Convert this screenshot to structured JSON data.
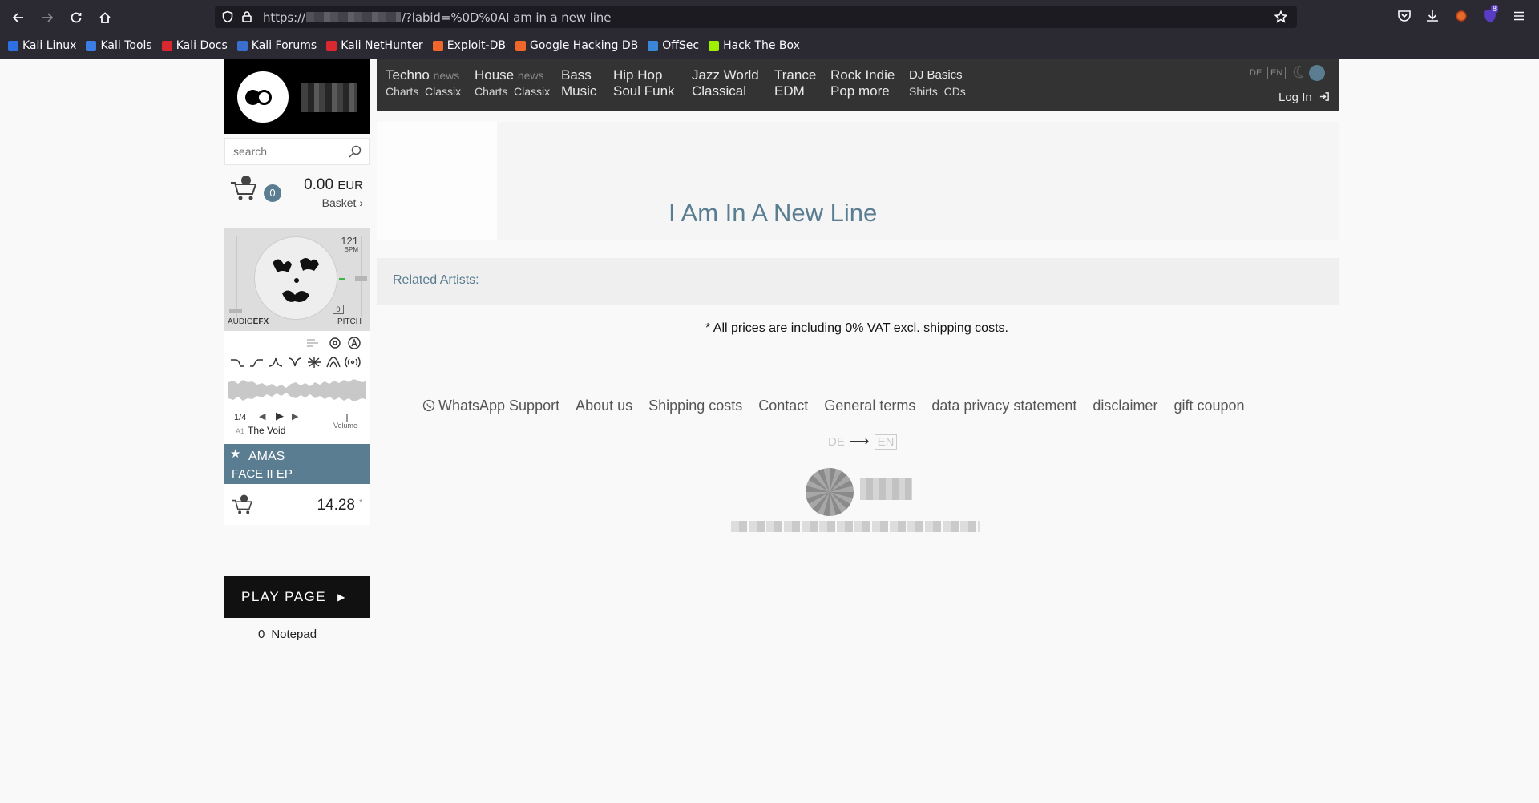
{
  "browser": {
    "url_prefix": "https://",
    "url_suffix": "/?labid=%0D%0AI am in a new line",
    "extensions_badge": "8",
    "bookmarks": [
      {
        "label": "Kali Linux",
        "color": "#2f6fe4"
      },
      {
        "label": "Kali Tools",
        "color": "#3b7de0"
      },
      {
        "label": "Kali Docs",
        "color": "#d9282f"
      },
      {
        "label": "Kali Forums",
        "color": "#3a6fd0"
      },
      {
        "label": "Kali NetHunter",
        "color": "#d9282f"
      },
      {
        "label": "Exploit-DB",
        "color": "#f0672b"
      },
      {
        "label": "Google Hacking DB",
        "color": "#f0672b"
      },
      {
        "label": "OffSec",
        "color": "#3a86d8"
      },
      {
        "label": "Hack The Box",
        "color": "#9fef00"
      }
    ]
  },
  "sidebar": {
    "search_placeholder": "search",
    "basket": {
      "count": "0",
      "amount": "0.00",
      "currency": "EUR",
      "label": "Basket ›"
    },
    "player": {
      "bpm": "121",
      "bpm_label": "BPM",
      "pitch_value": "0",
      "audio_label": "AUDIO",
      "efx_label": "EFX",
      "pitch_label": "PITCH",
      "track_position": "1/4",
      "volume_label": "Volume",
      "track_side": "A1",
      "track_title": "The Void"
    },
    "release": {
      "artist": "AMAS",
      "title": "FACE II EP",
      "price": "14.28",
      "price_marker": "*"
    },
    "play_page_label": "PLAY PAGE",
    "notepad": {
      "count": "0",
      "label": "Notepad"
    }
  },
  "topnav": {
    "techno": {
      "label": "Techno",
      "news": "news",
      "sub1": "Charts",
      "sub2": "Classix"
    },
    "house": {
      "label": "House",
      "news": "news",
      "sub1": "Charts",
      "sub2": "Classix"
    },
    "bass": {
      "l1": "Bass",
      "l2": "Music"
    },
    "hiphop": {
      "l1": "Hip Hop",
      "l2": "Soul Funk"
    },
    "jazz": {
      "l1": "Jazz World",
      "l2": "Classical"
    },
    "trance": {
      "l1": "Trance",
      "l2": "EDM"
    },
    "rock": {
      "l1": "Rock Indie",
      "l2": "Pop more"
    },
    "djbasics": {
      "l1": "DJ Basics",
      "sub1": "Shirts",
      "sub2": "CDs"
    },
    "lang_de": "DE",
    "lang_en": "EN",
    "login": "Log In"
  },
  "main": {
    "artist_title": "I Am In A New Line",
    "related_label": "Related Artists:",
    "vat_note": "* All prices are including 0% VAT excl. shipping costs."
  },
  "footer": {
    "links": {
      "whatsapp": "WhatsApp Support",
      "about": "About us",
      "shipping": "Shipping costs",
      "contact": "Contact",
      "terms": "General terms",
      "privacy": "data privacy statement",
      "disclaimer": "disclaimer",
      "coupon": "gift coupon"
    },
    "lang_from": "DE",
    "lang_arrow": "⟶",
    "lang_to": "EN"
  },
  "colors": {
    "accent": "#5a7d91",
    "nav_bg": "#333333",
    "chrome_bg": "#2b2a33"
  }
}
